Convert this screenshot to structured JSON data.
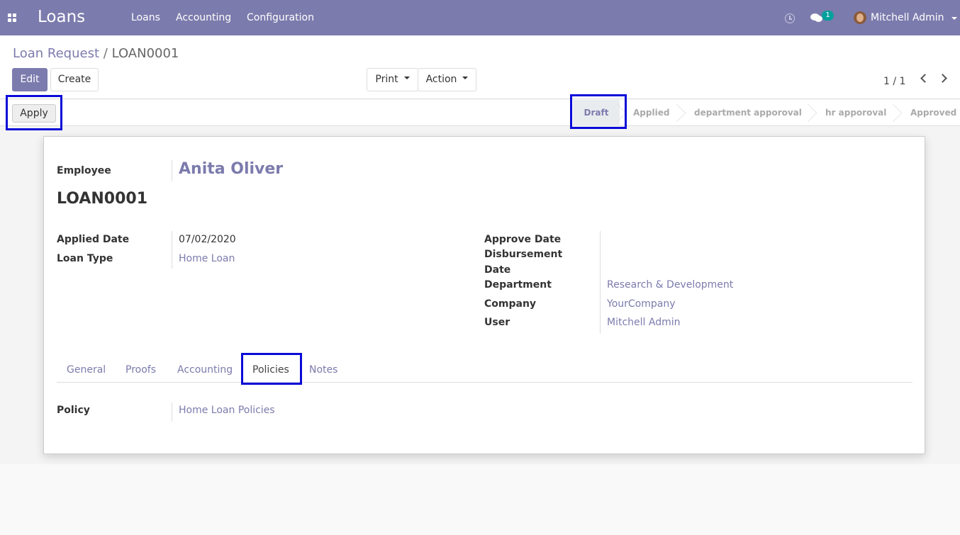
{
  "navbar": {
    "brand": "Loans",
    "menu": [
      "Loans",
      "Accounting",
      "Configuration"
    ],
    "notification_count": "1",
    "user_name": "Mitchell Admin"
  },
  "breadcrumb": {
    "parent": "Loan Request",
    "separator": "/",
    "current": "LOAN0001"
  },
  "toolbar": {
    "edit_label": "Edit",
    "create_label": "Create",
    "print_label": "Print",
    "action_label": "Action",
    "pager": "1 / 1"
  },
  "statusbar": {
    "apply_label": "Apply",
    "stages": [
      "Draft",
      "Applied",
      "department apporoval",
      "hr apporoval",
      "Approved"
    ],
    "active_stage": "Draft"
  },
  "form": {
    "employee_label": "Employee",
    "employee_value": "Anita Oliver",
    "loan_ref": "LOAN0001",
    "applied_date_label": "Applied Date",
    "applied_date_value": "07/02/2020",
    "loan_type_label": "Loan Type",
    "loan_type_value": "Home Loan",
    "approve_date_label": "Approve Date",
    "disbursement_label_1": "Disbursement",
    "disbursement_label_2": "Date",
    "department_label": "Department",
    "department_value": "Research & Development",
    "company_label": "Company",
    "company_value": "YourCompany",
    "user_label": "User",
    "user_value": "Mitchell Admin"
  },
  "tabs": [
    "General",
    "Proofs",
    "Accounting",
    "Policies",
    "Notes"
  ],
  "active_tab": "Policies",
  "policies": {
    "policy_label": "Policy",
    "policy_value": "Home Loan Policies"
  },
  "colors": {
    "brand": "#7c7bad",
    "highlight": "#0a0ad8",
    "badge": "#00a09d"
  }
}
